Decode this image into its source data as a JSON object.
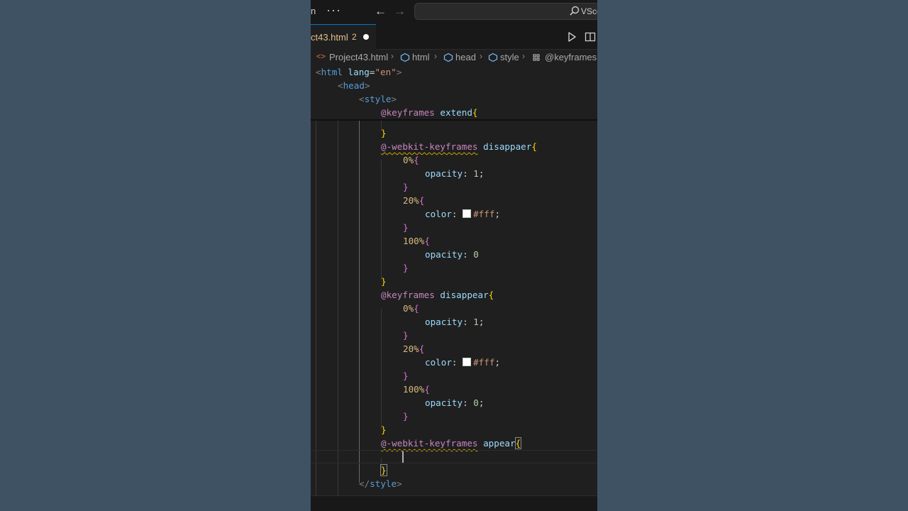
{
  "titlebar": {
    "left_fragment": "n",
    "menu_icon": "more-dots-icon",
    "back_icon": "arrow-left-icon",
    "forward_icon": "arrow-right-icon",
    "search_text": "VScc"
  },
  "tab": {
    "name": "ct43.html",
    "problems_count": "2",
    "modified_indicator": "unsaved-dot"
  },
  "breadcrumb": {
    "file": "Project43.html",
    "items": [
      "html",
      "head",
      "style",
      "@keyframes"
    ]
  },
  "code": {
    "lines": [
      "<html lang=\"en\">",
      "<head>",
      "<style>",
      "@keyframes extend{",
      "}",
      "@-webkit-keyframes disappaer{",
      "0%{",
      "opacity: 1;",
      "}",
      "20%{",
      "color: #fff;",
      "}",
      "100%{",
      "opacity: 0",
      "}",
      "}",
      "@keyframes disappear{",
      "0%{",
      "opacity: 1;",
      "}",
      "20%{",
      "color: #fff;",
      "}",
      "100%{",
      "opacity: 0;",
      "}",
      "}",
      "@-webkit-keyframes appear{",
      "",
      "}",
      "</style>"
    ],
    "tokens": {
      "html_tag": "<html",
      "lang_attr": "lang",
      "lang_value": "\"en\"",
      "head_tag": "<head>",
      "style_tag": "<style>",
      "at_keyframes": "@keyframes",
      "at_webkit": "@-webkit-keyframes",
      "name_extend": "extend",
      "name_disappaer": "disappaer",
      "name_disappear": "disappear",
      "name_appear": "appear",
      "pct0": "0%",
      "pct20": "20%",
      "pct100": "100%",
      "prop_opacity": "opacity",
      "prop_color": "color",
      "val_1": "1",
      "val_0": "0",
      "hex_fff": "#fff",
      "close_style": "</style>"
    },
    "colors": {
      "tag": "#569cd6",
      "at_rule": "#c586c0",
      "property": "#9cdcfe",
      "number": "#b5cea8",
      "string": "#ce9178",
      "brace_level1": "#ffd700",
      "brace_level2": "#da70d6"
    }
  }
}
